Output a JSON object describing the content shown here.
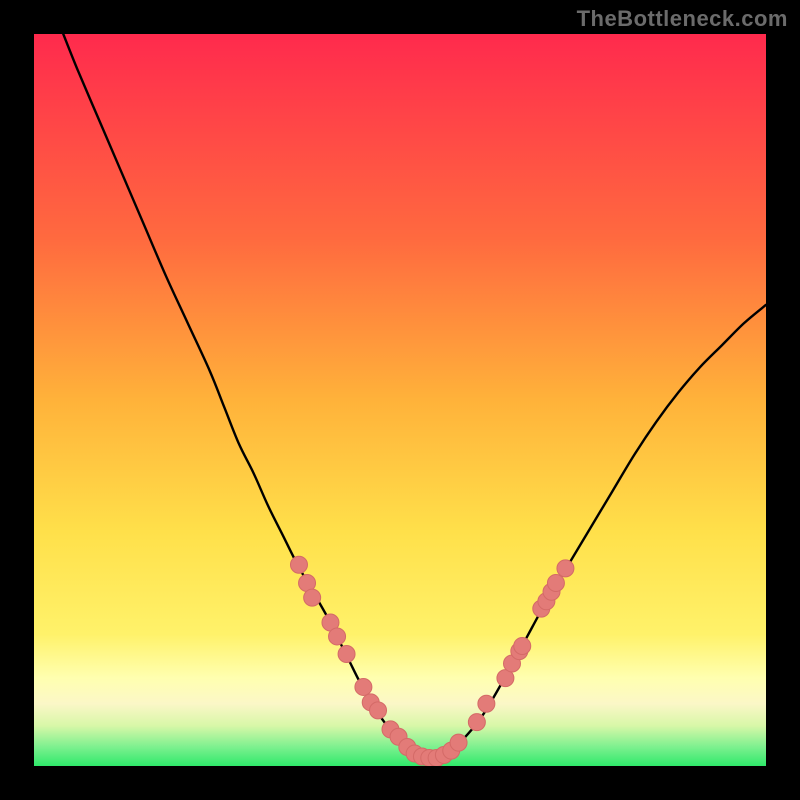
{
  "watermark": "TheBottleneck.com",
  "colors": {
    "frame": "#000000",
    "grad_top": "#ff2a4d",
    "grad_mid1": "#ff8a3a",
    "grad_mid2": "#ffcf3a",
    "grad_mid3": "#ffe94a",
    "grad_band1": "#ffffb0",
    "grad_band2": "#fbf7c7",
    "grad_green": "#2fe96a",
    "curve": "#000000",
    "marker_fill": "#e37b78",
    "marker_stroke": "#d46a67"
  },
  "chart_data": {
    "type": "line",
    "title": "",
    "xlabel": "",
    "ylabel": "",
    "xlim": [
      0,
      100
    ],
    "ylim": [
      0,
      100
    ],
    "series": [
      {
        "name": "bottleneck-curve",
        "x": [
          4,
          6,
          9,
          12,
          15,
          18,
          21,
          24,
          26,
          28,
          30,
          32,
          34,
          36,
          38,
          40,
          41.5,
          43,
          44.5,
          46,
          47.5,
          49,
          50.5,
          52,
          53.5,
          55,
          56.5,
          58,
          61,
          64,
          67,
          70,
          73,
          76,
          79,
          82,
          85,
          88,
          91,
          94,
          97,
          100
        ],
        "y": [
          100,
          95,
          88,
          81,
          74,
          67,
          60.5,
          54,
          49,
          44,
          40,
          35.5,
          31.5,
          27.5,
          24,
          20.5,
          17.5,
          14.5,
          11.5,
          9,
          6.5,
          4.5,
          3,
          1.8,
          1.3,
          1.3,
          1.8,
          3,
          6.5,
          11.5,
          17,
          22.5,
          27.5,
          32.5,
          37.5,
          42.5,
          47,
          51,
          54.5,
          57.5,
          60.5,
          63
        ]
      }
    ],
    "markers": {
      "name": "highlighted-points",
      "points": [
        {
          "x": 36.2,
          "y": 27.5
        },
        {
          "x": 37.3,
          "y": 25.0
        },
        {
          "x": 38.0,
          "y": 23.0
        },
        {
          "x": 40.5,
          "y": 19.6
        },
        {
          "x": 41.4,
          "y": 17.7
        },
        {
          "x": 42.7,
          "y": 15.3
        },
        {
          "x": 45.0,
          "y": 10.8
        },
        {
          "x": 46.0,
          "y": 8.7
        },
        {
          "x": 47.0,
          "y": 7.6
        },
        {
          "x": 48.7,
          "y": 5.0
        },
        {
          "x": 49.8,
          "y": 4.0
        },
        {
          "x": 51.0,
          "y": 2.6
        },
        {
          "x": 52.0,
          "y": 1.7
        },
        {
          "x": 53.0,
          "y": 1.3
        },
        {
          "x": 54.0,
          "y": 1.1
        },
        {
          "x": 55.0,
          "y": 1.1
        },
        {
          "x": 56.0,
          "y": 1.5
        },
        {
          "x": 57.0,
          "y": 2.1
        },
        {
          "x": 58.0,
          "y": 3.2
        },
        {
          "x": 60.5,
          "y": 6.0
        },
        {
          "x": 61.8,
          "y": 8.5
        },
        {
          "x": 64.4,
          "y": 12.0
        },
        {
          "x": 65.3,
          "y": 14.0
        },
        {
          "x": 66.3,
          "y": 15.7
        },
        {
          "x": 66.7,
          "y": 16.4
        },
        {
          "x": 69.3,
          "y": 21.5
        },
        {
          "x": 70.0,
          "y": 22.5
        },
        {
          "x": 70.7,
          "y": 23.8
        },
        {
          "x": 71.3,
          "y": 25.0
        },
        {
          "x": 72.6,
          "y": 27.0
        }
      ]
    }
  }
}
